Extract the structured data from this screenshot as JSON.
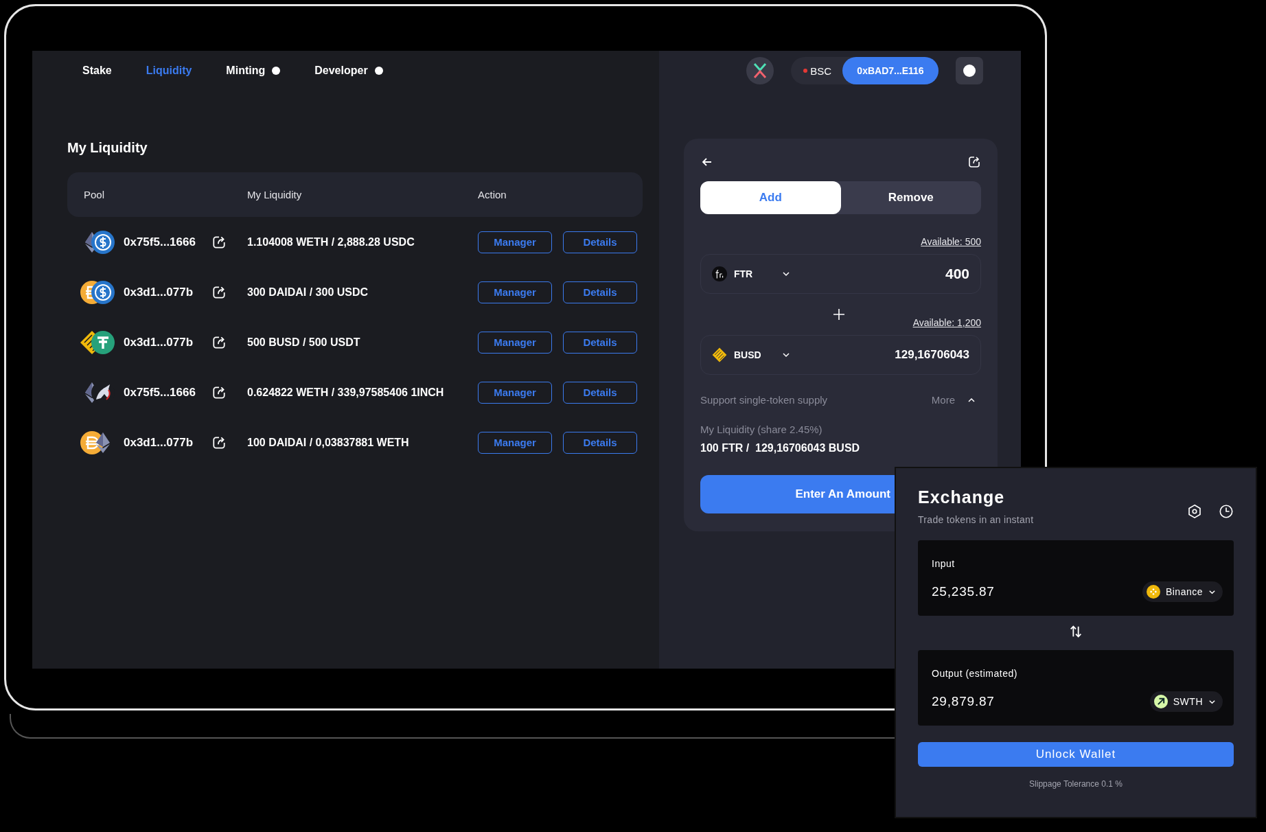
{
  "nav": {
    "tabs": [
      {
        "label": "Stake",
        "selected": false,
        "dot": false
      },
      {
        "label": "Liquidity",
        "selected": true,
        "dot": false
      },
      {
        "label": "Minting",
        "selected": false,
        "dot": true
      },
      {
        "label": "Developer",
        "selected": false,
        "dot": true
      }
    ],
    "network": {
      "label": "BSC",
      "color": "#e53935"
    },
    "wallet": "0xBAD7...E116"
  },
  "liquidity": {
    "title": "My Liquidity",
    "columns": [
      "Pool",
      "My Liquidity",
      "Action"
    ],
    "rows": [
      {
        "tokens": [
          {
            "kind": "eth"
          },
          {
            "kind": "usdc"
          }
        ],
        "pool": "0x75f5...1666",
        "amount": "1.104008 WETH / 2,888.28 USDC",
        "actions": [
          "Manager",
          "Details"
        ]
      },
      {
        "tokens": [
          {
            "kind": "dai"
          },
          {
            "kind": "usdc"
          }
        ],
        "pool": "0x3d1...077b",
        "amount": "300 DAIDAI / 300 USDC",
        "actions": [
          "Manager",
          "Details"
        ]
      },
      {
        "tokens": [
          {
            "kind": "busd"
          },
          {
            "kind": "usdt"
          }
        ],
        "pool": "0x3d1...077b",
        "amount": "500 BUSD / 500 USDT",
        "actions": [
          "Manager",
          "Details"
        ]
      },
      {
        "tokens": [
          {
            "kind": "eth"
          },
          {
            "kind": "oneinch"
          }
        ],
        "pool": "0x75f5...1666",
        "amount": "0.624822 WETH / 339,97585406 1INCH",
        "actions": [
          "Manager",
          "Details"
        ]
      },
      {
        "tokens": [
          {
            "kind": "dai"
          },
          {
            "kind": "eth"
          }
        ],
        "pool": "0x3d1...077b",
        "amount": "100 DAIDAI / 0,03837881 WETH",
        "actions": [
          "Manager",
          "Details"
        ]
      }
    ]
  },
  "panel": {
    "tabs": [
      {
        "label": "Add",
        "selected": true
      },
      {
        "label": "Remove",
        "selected": false
      }
    ],
    "fields": [
      {
        "available": "Available: 500",
        "token": "FTR",
        "kind": "ftr",
        "value": "400",
        "emphasized": true
      },
      {
        "available": "Available: 1,200",
        "token": "BUSD",
        "kind": "busd",
        "value": "129,16706043",
        "emphasized": false
      }
    ],
    "support": "Support single-token supply",
    "more": "More",
    "expanded": true,
    "share_label": "My Liquidity (share 2.45%)",
    "share_value": "100 FTR /  129,16706043 BUSD",
    "submit": "Enter An Amount"
  },
  "exchange": {
    "title": "Exchange",
    "subtitle": "Trade tokens in an instant",
    "input": {
      "label": "Input",
      "value": "25,235.87",
      "token": "Binance",
      "kind": "bnb"
    },
    "output": {
      "label": "Output (estimated)",
      "value": "29,879.87",
      "token": "SWTH",
      "kind": "swth"
    },
    "button": "Unlock Wallet",
    "slippage": "Slippage Tolerance 0.1 %"
  }
}
